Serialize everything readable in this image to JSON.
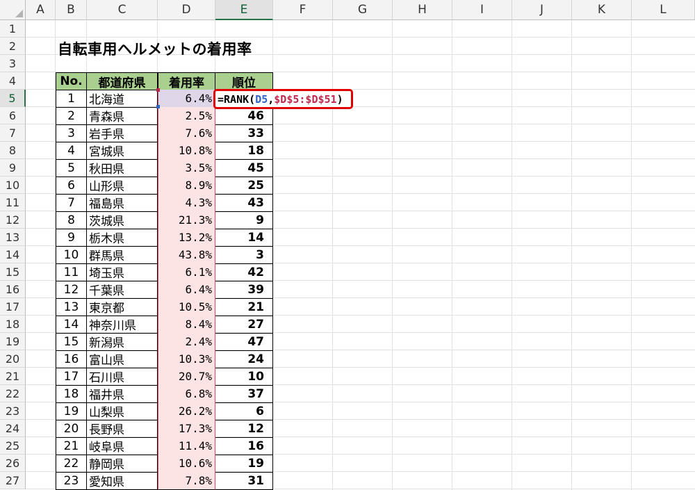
{
  "sheet": {
    "columns": [
      "A",
      "B",
      "C",
      "D",
      "E",
      "F",
      "G",
      "H",
      "I",
      "J",
      "K",
      "L"
    ],
    "rows": [
      "1",
      "2",
      "3",
      "4",
      "5",
      "6",
      "7",
      "8",
      "9",
      "10",
      "11",
      "12",
      "13",
      "14",
      "15",
      "16",
      "17",
      "18",
      "19",
      "20",
      "21",
      "22",
      "23",
      "24",
      "25",
      "26",
      "27"
    ],
    "selected_column": "E",
    "selected_row": "5",
    "title": "自転車用ヘルメットの着用率",
    "headers": {
      "no": "No.",
      "pref": "都道府県",
      "rate": "着用率",
      "rank": "順位"
    },
    "active_formula": {
      "prefix": "=RANK(",
      "ref": "D5",
      "sep": ",",
      "range": "$D$5:$D$51",
      "suffix": ")",
      "highlight_color": "#e00000"
    },
    "records": [
      {
        "no": "1",
        "pref": "北海道",
        "rate": "6.4%",
        "rank": ""
      },
      {
        "no": "2",
        "pref": "青森県",
        "rate": "2.5%",
        "rank": "46"
      },
      {
        "no": "3",
        "pref": "岩手県",
        "rate": "7.6%",
        "rank": "33"
      },
      {
        "no": "4",
        "pref": "宮城県",
        "rate": "10.8%",
        "rank": "18"
      },
      {
        "no": "5",
        "pref": "秋田県",
        "rate": "3.5%",
        "rank": "45"
      },
      {
        "no": "6",
        "pref": "山形県",
        "rate": "8.9%",
        "rank": "25"
      },
      {
        "no": "7",
        "pref": "福島県",
        "rate": "4.3%",
        "rank": "43"
      },
      {
        "no": "8",
        "pref": "茨城県",
        "rate": "21.3%",
        "rank": "9"
      },
      {
        "no": "9",
        "pref": "栃木県",
        "rate": "13.2%",
        "rank": "14"
      },
      {
        "no": "10",
        "pref": "群馬県",
        "rate": "43.8%",
        "rank": "3"
      },
      {
        "no": "11",
        "pref": "埼玉県",
        "rate": "6.1%",
        "rank": "42"
      },
      {
        "no": "12",
        "pref": "千葉県",
        "rate": "6.4%",
        "rank": "39"
      },
      {
        "no": "13",
        "pref": "東京都",
        "rate": "10.5%",
        "rank": "21"
      },
      {
        "no": "14",
        "pref": "神奈川県",
        "rate": "8.4%",
        "rank": "27"
      },
      {
        "no": "15",
        "pref": "新潟県",
        "rate": "2.4%",
        "rank": "47"
      },
      {
        "no": "16",
        "pref": "富山県",
        "rate": "10.3%",
        "rank": "24"
      },
      {
        "no": "17",
        "pref": "石川県",
        "rate": "20.7%",
        "rank": "10"
      },
      {
        "no": "18",
        "pref": "福井県",
        "rate": "6.8%",
        "rank": "37"
      },
      {
        "no": "19",
        "pref": "山梨県",
        "rate": "26.2%",
        "rank": "6"
      },
      {
        "no": "20",
        "pref": "長野県",
        "rate": "17.3%",
        "rank": "12"
      },
      {
        "no": "21",
        "pref": "岐阜県",
        "rate": "11.4%",
        "rank": "16"
      },
      {
        "no": "22",
        "pref": "静岡県",
        "rate": "10.6%",
        "rank": "19"
      },
      {
        "no": "23",
        "pref": "愛知県",
        "rate": "7.8%",
        "rank": "31"
      }
    ],
    "colors": {
      "header_fill": "#a9d08e",
      "rate_fill": "#fce4e4",
      "rate_border": "#d94a68",
      "selection": "#217346",
      "ref_blue": "#3163c5",
      "ref_red": "#c0284b"
    }
  }
}
